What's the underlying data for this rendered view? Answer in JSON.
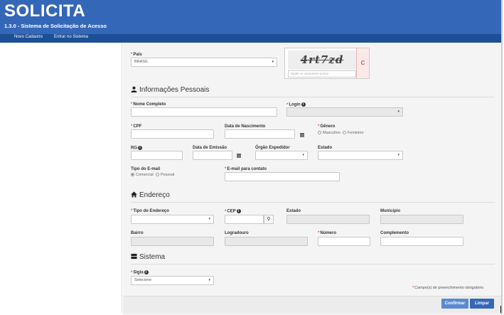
{
  "header": {
    "brand": "SOLICITA",
    "subtitle": "1.3.0 - Sistema de Solicitação de Acesso"
  },
  "nav": {
    "items": [
      {
        "label": "Novo Cadastro"
      },
      {
        "label": "Entrar no Sistema"
      }
    ]
  },
  "form": {
    "pais": {
      "label": "País",
      "value": "BRASIL"
    },
    "captcha": {
      "text": "4rt7zd",
      "placeholder": "Digite os caracteres acima"
    },
    "sections": {
      "pessoais": "Informações Pessoais",
      "endereco": "Endereço",
      "sistema": "Sistema"
    },
    "nome": {
      "label": "Nome Completo"
    },
    "login": {
      "label": "Login"
    },
    "cpf": {
      "label": "CPF"
    },
    "nascimento": {
      "label": "Data de Nascimento"
    },
    "genero": {
      "label": "Gênero",
      "options": [
        "Masculino",
        "Feminino"
      ]
    },
    "rg": {
      "label": "RG"
    },
    "emissao": {
      "label": "Data de Emissão"
    },
    "orgao": {
      "label": "Órgão Expedidor"
    },
    "estado": {
      "label": "Estado"
    },
    "tipo_email": {
      "label": "Tipo do E-mail",
      "options": [
        "Comercial",
        "Pessoal"
      ]
    },
    "email": {
      "label": "E-mail para contato"
    },
    "tipo_endereco": {
      "label": "Tipo do Endereço"
    },
    "cep": {
      "label": "CEP"
    },
    "estado_end": {
      "label": "Estado"
    },
    "municipio": {
      "label": "Município"
    },
    "bairro": {
      "label": "Bairro"
    },
    "logradouro": {
      "label": "Logradouro"
    },
    "numero": {
      "label": "Número"
    },
    "complemento": {
      "label": "Complemento"
    },
    "sigla": {
      "label": "Sigla",
      "value": "Selecione"
    },
    "required_note": "Campo(s) de preenchimento obrigatório"
  },
  "buttons": {
    "confirmar": "Confirmar",
    "limpar": "Limpar"
  },
  "colors": {
    "header": "#3567b8",
    "navbar": "#1d4f96",
    "required": "#e05555"
  }
}
